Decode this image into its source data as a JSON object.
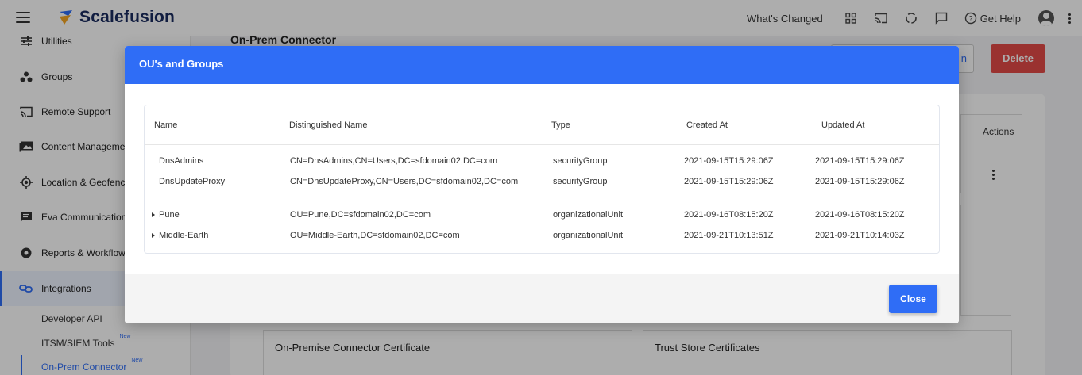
{
  "app": {
    "logo_text": "Scalefusion",
    "brand_color": "#2f6df6"
  },
  "topbar": {
    "whats_changed": "What's Changed",
    "get_help": "Get Help",
    "icons": [
      "apps-grid-icon",
      "cast-icon",
      "sync-icon",
      "chat-icon",
      "help-icon",
      "account-icon",
      "more-vert-icon"
    ]
  },
  "sidebar": {
    "items": [
      {
        "label": "Utilities",
        "icon": "sliders-icon"
      },
      {
        "label": "Groups",
        "icon": "groups-icon"
      },
      {
        "label": "Remote Support",
        "icon": "cast-icon"
      },
      {
        "label": "Content Management",
        "icon": "photo-library-icon"
      },
      {
        "label": "Location & Geofencing",
        "icon": "location-target-icon"
      },
      {
        "label": "Eva Communication Suite",
        "icon": "message-icon"
      },
      {
        "label": "Reports & Workflows",
        "icon": "report-gear-icon"
      },
      {
        "label": "Integrations",
        "icon": "integration-link-icon"
      }
    ],
    "sub_items": [
      {
        "label": "Developer API",
        "badge": ""
      },
      {
        "label": "ITSM/SIEM Tools",
        "badge": "New"
      },
      {
        "label": "On-Prem Connector",
        "badge": "New"
      }
    ]
  },
  "background_page": {
    "title": "On-Prem Connector",
    "outline_button_tail": "n",
    "delete_button": "Delete",
    "actions_header": "Actions",
    "cert_box_title": "On-Premise Connector Certificate",
    "trust_box_title": "Trust Store Certificates"
  },
  "modal": {
    "title": "OU's and Groups",
    "columns": [
      "Name",
      "Distinguished Name",
      "Type",
      "Created At",
      "Updated At"
    ],
    "rows": [
      {
        "name": "DnsAdmins",
        "dn": "CN=DnsAdmins,CN=Users,DC=sfdomain02,DC=com",
        "type": "securityGroup",
        "created": "2021-09-15T15:29:06Z",
        "updated": "2021-09-15T15:29:06Z",
        "expandable": false
      },
      {
        "name": "DnsUpdateProxy",
        "dn": "CN=DnsUpdateProxy,CN=Users,DC=sfdomain02,DC=com",
        "type": "securityGroup",
        "created": "2021-09-15T15:29:06Z",
        "updated": "2021-09-15T15:29:06Z",
        "expandable": false
      },
      {
        "name": "Pune",
        "dn": "OU=Pune,DC=sfdomain02,DC=com",
        "type": "organizationalUnit",
        "created": "2021-09-16T08:15:20Z",
        "updated": "2021-09-16T08:15:20Z",
        "expandable": true
      },
      {
        "name": "Middle-Earth",
        "dn": "OU=Middle-Earth,DC=sfdomain02,DC=com",
        "type": "organizationalUnit",
        "created": "2021-09-21T10:13:51Z",
        "updated": "2021-09-21T10:14:03Z",
        "expandable": true
      }
    ],
    "close_button": "Close"
  }
}
